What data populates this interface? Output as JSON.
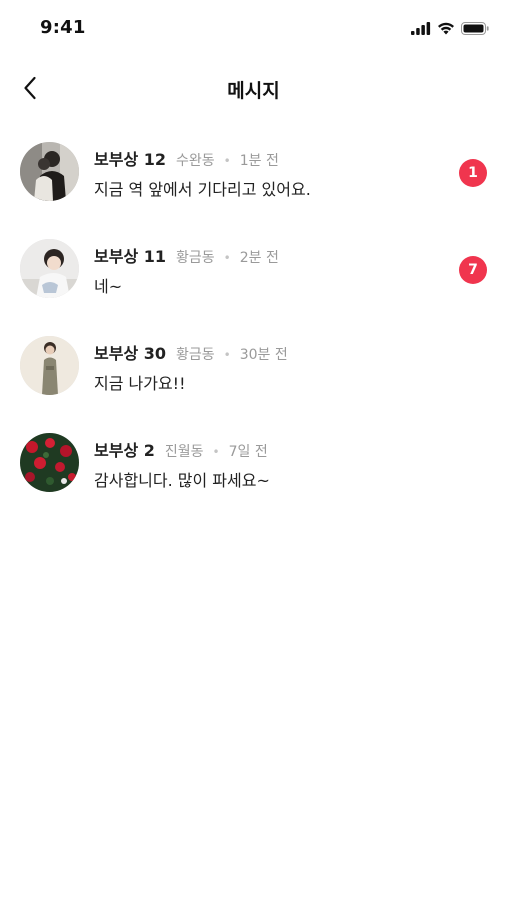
{
  "status_bar": {
    "time": "9:41",
    "icons": [
      "signal-icon",
      "wifi-icon",
      "battery-icon"
    ]
  },
  "header": {
    "back_icon": "chevron-left-icon",
    "title": "메시지"
  },
  "colors": {
    "badge": "#f0354e",
    "meta_text": "#9a9a9a",
    "primary_text": "#222222"
  },
  "messages": [
    {
      "name": "보부상 12",
      "location": "수완동",
      "time": "1분 전",
      "text": "지금 역 앞에서 기다리고 있어요.",
      "unread": "1"
    },
    {
      "name": "보부상 11",
      "location": "황금동",
      "time": "2분 전",
      "text": "네~",
      "unread": "7"
    },
    {
      "name": "보부상 30",
      "location": "황금동",
      "time": "30분 전",
      "text": "지금 나가요!!",
      "unread": null
    },
    {
      "name": "보부상 2",
      "location": "진월동",
      "time": "7일 전",
      "text": "감사합니다. 많이 파세요~",
      "unread": null
    }
  ]
}
